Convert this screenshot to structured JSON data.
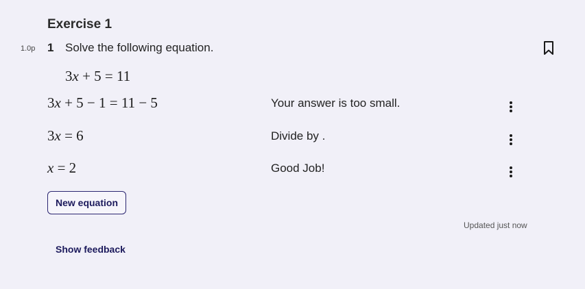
{
  "exercise": {
    "title": "Exercise 1"
  },
  "question": {
    "points": "1.0p",
    "number": "1",
    "text": "Solve the following equation.",
    "given_equation": [
      {
        "t": "3"
      },
      {
        "t": "x",
        "i": true
      },
      {
        "t": " + 5 = 11"
      }
    ]
  },
  "steps": [
    {
      "equation": [
        {
          "t": "3"
        },
        {
          "t": "x",
          "i": true
        },
        {
          "t": " + 5 − 1 = 11 − 5"
        }
      ],
      "feedback": "Your answer is too small."
    },
    {
      "equation": [
        {
          "t": "3"
        },
        {
          "t": "x",
          "i": true
        },
        {
          "t": " = 6"
        }
      ],
      "feedback": "Divide by ."
    },
    {
      "equation": [
        {
          "t": "x",
          "i": true
        },
        {
          "t": " = 2"
        }
      ],
      "feedback": "Good Job!"
    }
  ],
  "actions": {
    "new_equation_label": "New equation",
    "show_feedback_label": "Show feedback"
  },
  "status": {
    "updated_text": "Updated just now"
  },
  "icons": {
    "bookmark": "bookmark-icon",
    "step_menu": "more-vertical-icon"
  },
  "colors": {
    "background": "#f1f0f8",
    "accent": "#1c1a5c"
  }
}
